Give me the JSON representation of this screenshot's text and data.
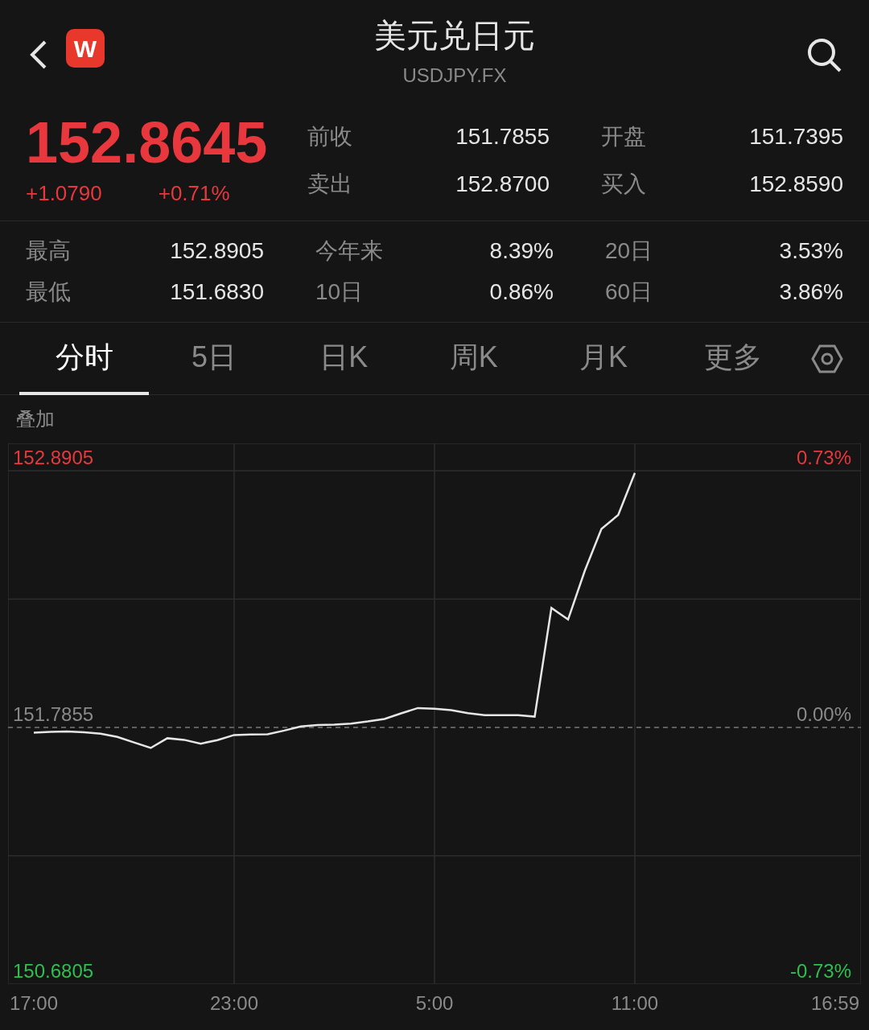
{
  "header": {
    "title": "美元兑日元",
    "subtitle": "USDJPY.FX",
    "logo": "W"
  },
  "quote": {
    "price": "152.8645",
    "change": "+1.0790",
    "change_pct": "+0.71%"
  },
  "quote_stats": [
    {
      "label": "前收",
      "value": "151.7855"
    },
    {
      "label": "开盘",
      "value": "151.7395"
    },
    {
      "label": "卖出",
      "value": "152.8700"
    },
    {
      "label": "买入",
      "value": "152.8590"
    }
  ],
  "stats": [
    {
      "label": "最高",
      "value": "152.8905"
    },
    {
      "label": "今年来",
      "value": "8.39%"
    },
    {
      "label": "20日",
      "value": "3.53%"
    },
    {
      "label": "最低",
      "value": "151.6830"
    },
    {
      "label": "10日",
      "value": "0.86%"
    },
    {
      "label": "60日",
      "value": "3.86%"
    }
  ],
  "tabs": [
    {
      "label": "分时",
      "selected": true
    },
    {
      "label": "5日",
      "selected": false
    },
    {
      "label": "日K",
      "selected": false
    },
    {
      "label": "周K",
      "selected": false
    },
    {
      "label": "月K",
      "selected": false
    },
    {
      "label": "更多",
      "selected": false
    }
  ],
  "overlay_label": "叠加",
  "chart": {
    "right_labels": [
      "0.73%",
      "0.00%",
      "-0.73%"
    ],
    "chart_data": {
      "type": "line",
      "categories": [
        "17:00",
        null,
        null,
        null,
        null,
        null,
        null,
        null,
        null,
        null,
        null,
        null,
        "23:00",
        null,
        null,
        null,
        null,
        null,
        null,
        null,
        null,
        null,
        null,
        null,
        "5:00",
        null,
        null,
        null,
        null,
        null,
        null,
        null,
        null,
        null,
        null,
        null,
        "11:00",
        null,
        null,
        null,
        null,
        null,
        null,
        null,
        null,
        null,
        null,
        null,
        "16:59"
      ],
      "series": [
        {
          "color": "#e6e6e6",
          "values": [
            151.763,
            151.766,
            151.768,
            151.765,
            151.759,
            151.745,
            151.721,
            151.697,
            151.739,
            151.732,
            151.716,
            151.731,
            151.753,
            151.755,
            151.756,
            151.772,
            151.79,
            151.796,
            151.798,
            151.802,
            151.811,
            151.822,
            151.846,
            151.869,
            151.866,
            151.86,
            151.847,
            151.838,
            151.838,
            151.838,
            151.832,
            152.3,
            152.25,
            152.46,
            152.64,
            152.7,
            152.881,
            null,
            null,
            null,
            null,
            null,
            null,
            null,
            null,
            null,
            null,
            null,
            null
          ]
        }
      ],
      "ylim": [
        150.6805,
        152.8905
      ],
      "grid": true,
      "ref_lines": [
        {
          "axis": "y",
          "value": 151.7855
        }
      ],
      "yticks": [
        {
          "value": 152.8905,
          "label": "152.8905"
        },
        {
          "value": 151.7855,
          "label": "151.7855"
        },
        {
          "value": 150.6805,
          "label": "150.6805"
        }
      ]
    }
  }
}
